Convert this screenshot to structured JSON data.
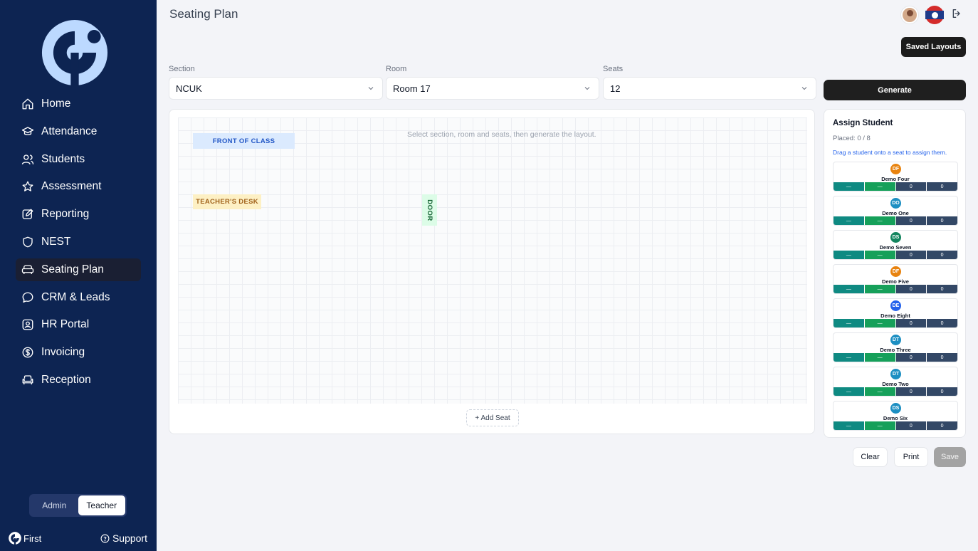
{
  "brand": {
    "short_name": "First"
  },
  "sidebar": {
    "items": [
      {
        "label": "Home",
        "icon": "home-icon"
      },
      {
        "label": "Attendance",
        "icon": "graduation-cap-icon"
      },
      {
        "label": "Students",
        "icon": "users-icon"
      },
      {
        "label": "Assessment",
        "icon": "star-icon"
      },
      {
        "label": "Reporting",
        "icon": "edit-icon"
      },
      {
        "label": "NEST",
        "icon": "shield-icon"
      },
      {
        "label": "Seating Plan",
        "icon": "sofa-icon",
        "active": true
      },
      {
        "label": "CRM & Leads",
        "icon": "chat-icon"
      },
      {
        "label": "HR Portal",
        "icon": "id-badge-icon"
      },
      {
        "label": "Invoicing",
        "icon": "dollar-icon"
      },
      {
        "label": "Reception",
        "icon": "armchair-icon"
      }
    ],
    "roles": {
      "admin": "Admin",
      "teacher": "Teacher",
      "active": "Teacher"
    },
    "support_label": "Support"
  },
  "header": {
    "title": "Seating Plan",
    "saved_layouts_label": "Saved Layouts"
  },
  "filters": {
    "section": {
      "label": "Section",
      "value": "NCUK"
    },
    "room": {
      "label": "Room",
      "value": "Room 17"
    },
    "seats": {
      "label": "Seats",
      "value": "12"
    },
    "generate_label": "Generate"
  },
  "canvas": {
    "hint": "Select section, room and seats, then generate the layout.",
    "front_label": "FRONT OF CLASS",
    "desk_label": "TEACHER'S DESK",
    "door_label": "DOOR",
    "add_seat_label": "+ Add Seat"
  },
  "assign": {
    "title": "Assign Student",
    "placed": "Placed: 0 / 8",
    "hint": "Drag a student onto a seat to assign them.",
    "students": [
      {
        "initials": "DF",
        "name": "Demo Four",
        "color": "#e8830f",
        "stats": [
          "—",
          "—",
          "0",
          "0"
        ]
      },
      {
        "initials": "DO",
        "name": "Demo One",
        "color": "#1d8fc2",
        "stats": [
          "—",
          "—",
          "0",
          "0"
        ]
      },
      {
        "initials": "DS",
        "name": "Demo Seven",
        "color": "#14855f",
        "stats": [
          "—",
          "—",
          "0",
          "0"
        ]
      },
      {
        "initials": "DF",
        "name": "Demo Five",
        "color": "#e8830f",
        "stats": [
          "—",
          "—",
          "0",
          "0"
        ]
      },
      {
        "initials": "DE",
        "name": "Demo Eight",
        "color": "#2563eb",
        "stats": [
          "—",
          "—",
          "0",
          "0"
        ]
      },
      {
        "initials": "DT",
        "name": "Demo Three",
        "color": "#1d8fc2",
        "stats": [
          "—",
          "—",
          "0",
          "0"
        ]
      },
      {
        "initials": "DT",
        "name": "Demo Two",
        "color": "#1d8fc2",
        "stats": [
          "—",
          "—",
          "0",
          "0"
        ]
      },
      {
        "initials": "DS",
        "name": "Demo Six",
        "color": "#1d8fc2",
        "stats": [
          "—",
          "—",
          "0",
          "0"
        ]
      }
    ]
  },
  "actions": {
    "clear": "Clear",
    "print": "Print",
    "save": "Save"
  },
  "colors": {
    "sidebar_bg": "#0d2452",
    "brand_blue": "#bcd9ff",
    "dark_button": "#1f1f1f"
  }
}
